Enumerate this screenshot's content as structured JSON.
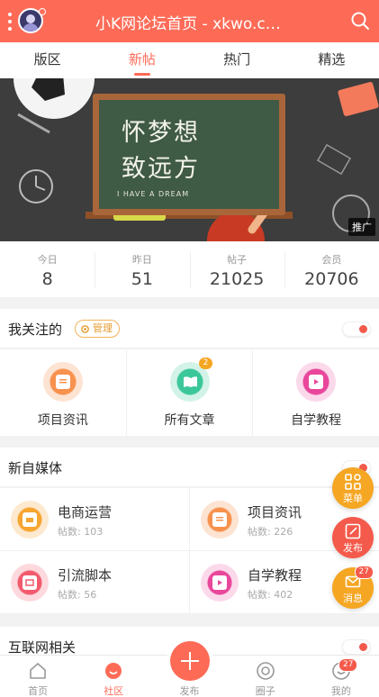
{
  "header": {
    "title": "小K网论坛首页 - xkwo.com",
    "search_icon": "search-icon",
    "color": "#fd6b57"
  },
  "tabs": [
    {
      "label": "版区"
    },
    {
      "label": "新帖",
      "active": true
    },
    {
      "label": "热门"
    },
    {
      "label": "精选"
    }
  ],
  "banner": {
    "line1": "怀梦想",
    "line2": "致远方",
    "line3": "I HAVE A DREAM",
    "ad_label": "推广"
  },
  "stats": [
    {
      "label": "今日",
      "value": "8"
    },
    {
      "label": "昨日",
      "value": "51"
    },
    {
      "label": "帖子",
      "value": "21025"
    },
    {
      "label": "会员",
      "value": "20706"
    }
  ],
  "followed": {
    "title": "我关注的",
    "manage_label": "管理",
    "items": [
      {
        "label": "项目资讯",
        "icon": "clipboard-icon"
      },
      {
        "label": "所有文章",
        "icon": "book-icon",
        "badge": "2"
      },
      {
        "label": "自学教程",
        "icon": "video-icon"
      }
    ]
  },
  "media": {
    "title": "新自媒体",
    "items": [
      {
        "name": "电商运营",
        "count": "帖数: 103",
        "icon": "cart-icon"
      },
      {
        "name": "项目资讯",
        "count": "帖数: 226",
        "icon": "clipboard-icon"
      },
      {
        "name": "引流脚本",
        "count": "帖数: 56",
        "icon": "script-icon"
      },
      {
        "name": "自学教程",
        "count": "帖数: 402",
        "icon": "video-icon"
      }
    ]
  },
  "internet": {
    "title": "互联网相关"
  },
  "fabs": [
    {
      "label": "菜单",
      "icon": "grid-icon",
      "color": "#f5a623"
    },
    {
      "label": "发布",
      "icon": "edit-icon",
      "color": "#f45a4b"
    },
    {
      "label": "消息",
      "icon": "mail-icon",
      "color": "#f5a623",
      "badge": "27"
    }
  ],
  "bottom_nav": [
    {
      "label": "首页",
      "icon": "home-icon"
    },
    {
      "label": "社区",
      "icon": "community-icon",
      "active": true
    },
    {
      "label": "发布",
      "icon": "plus-icon"
    },
    {
      "label": "圈子",
      "icon": "circle-icon"
    },
    {
      "label": "我的",
      "icon": "user-icon",
      "badge": "27"
    }
  ]
}
